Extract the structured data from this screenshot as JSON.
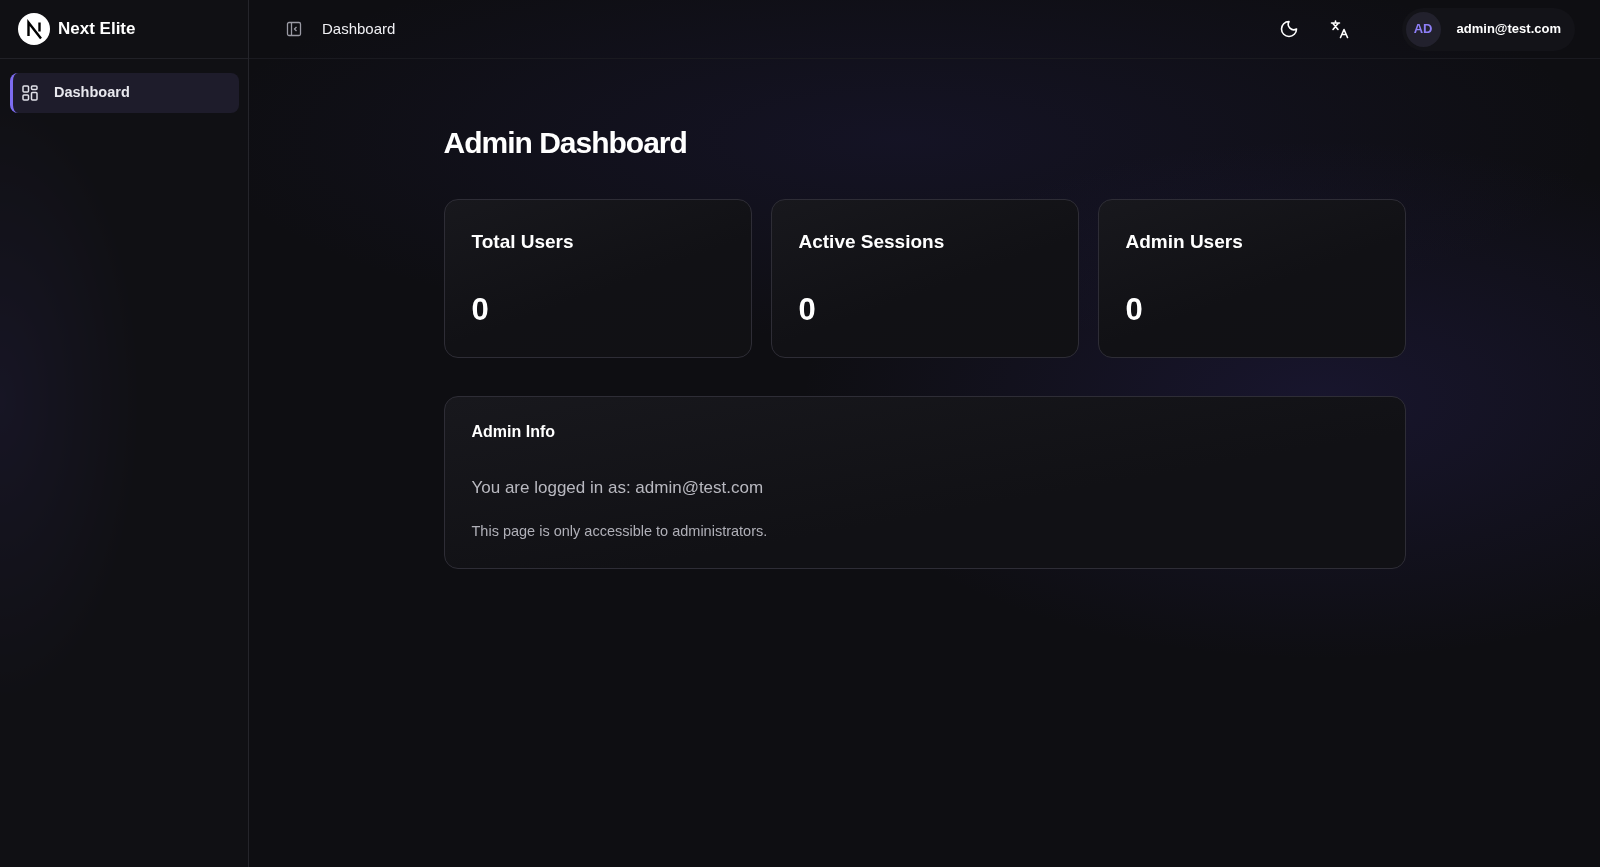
{
  "brand": {
    "name": "Next Elite"
  },
  "sidebar": {
    "items": [
      {
        "label": "Dashboard",
        "selected": true
      }
    ]
  },
  "header": {
    "breadcrumb": "Dashboard",
    "user": {
      "initials": "AD",
      "email": "admin@test.com"
    }
  },
  "page": {
    "title": "Admin Dashboard",
    "stats": [
      {
        "label": "Total Users",
        "value": "0"
      },
      {
        "label": "Active Sessions",
        "value": "0"
      },
      {
        "label": "Admin Users",
        "value": "0"
      }
    ],
    "info": {
      "title": "Admin Info",
      "lines": [
        "You are logged in as: admin@test.com",
        "This page is only accessible to administrators."
      ]
    }
  }
}
